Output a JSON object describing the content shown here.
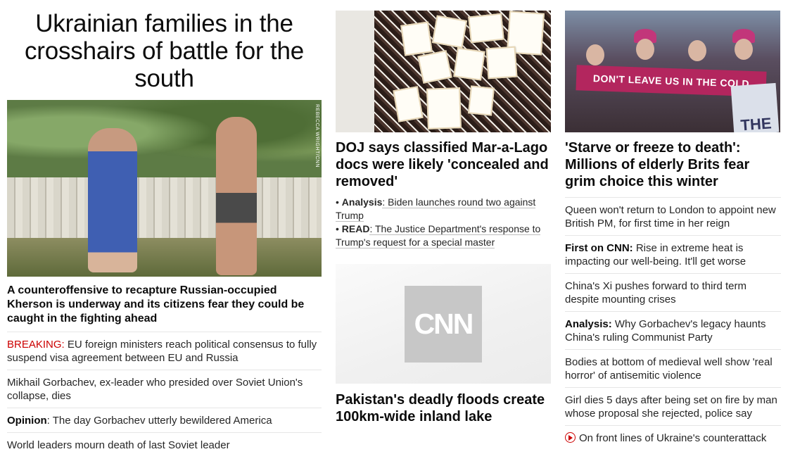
{
  "col1": {
    "headline": "Ukrainian families in the crosshairs of battle for the south",
    "image_credit": "REBECCA WRIGHT/CNN",
    "subhead": "A counteroffensive to recapture Russian-occupied Kherson is underway and its citizens fear they could be caught in the fighting ahead",
    "items": [
      {
        "prefix": "BREAKING:",
        "text": " EU foreign ministers reach political consensus to fully suspend visa agreement between EU and Russia"
      },
      {
        "prefix": "",
        "text": "Mikhail Gorbachev, ex-leader who presided over Soviet Union's collapse, dies"
      },
      {
        "prefix": "Opinion",
        "text": ": The day Gorbachev utterly bewildered America"
      },
      {
        "prefix": "",
        "text": "World leaders mourn death of last Soviet leader"
      }
    ]
  },
  "col2": {
    "headline": "DOJ says classified Mar-a-Lago docs were likely 'concealed and removed'",
    "bullets": [
      {
        "label": "Analysis",
        "text": ": Biden launches round two against Trump"
      },
      {
        "label": "READ",
        "text": ": The Justice Department's response to Trump's request for a special master"
      }
    ],
    "logo_text": "CNN",
    "headline2": "Pakistan's deadly floods create 100km-wide inland lake"
  },
  "col3": {
    "banner_text": "DON'T LEAVE US IN THE COLD",
    "sign_text": "THE",
    "headline": "'Starve or freeze to death': Millions of elderly Brits fear grim choice this winter",
    "items": [
      {
        "prefix": "",
        "text": "Queen won't return to London to appoint new British PM, for first time in her reign"
      },
      {
        "prefix": "First on CNN:",
        "text": " Rise in extreme heat is impacting our well-being. It'll get worse"
      },
      {
        "prefix": "",
        "text": "China's Xi pushes forward to third term despite mounting crises"
      },
      {
        "prefix": "Analysis:",
        "text": " Why Gorbachev's legacy haunts China's ruling Communist Party"
      },
      {
        "prefix": "",
        "text": "Bodies at bottom of medieval well show 'real horror' of antisemitic violence"
      },
      {
        "prefix": "",
        "text": "Girl dies 5 days after being set on fire by man whose proposal she rejected, police say"
      },
      {
        "prefix": "",
        "text": "On front lines of Ukraine's counterattack",
        "icon": "play-icon"
      }
    ]
  },
  "colors": {
    "breaking": "#cc0000",
    "text": "#0c0c0c",
    "divider": "#e6e6e6"
  }
}
